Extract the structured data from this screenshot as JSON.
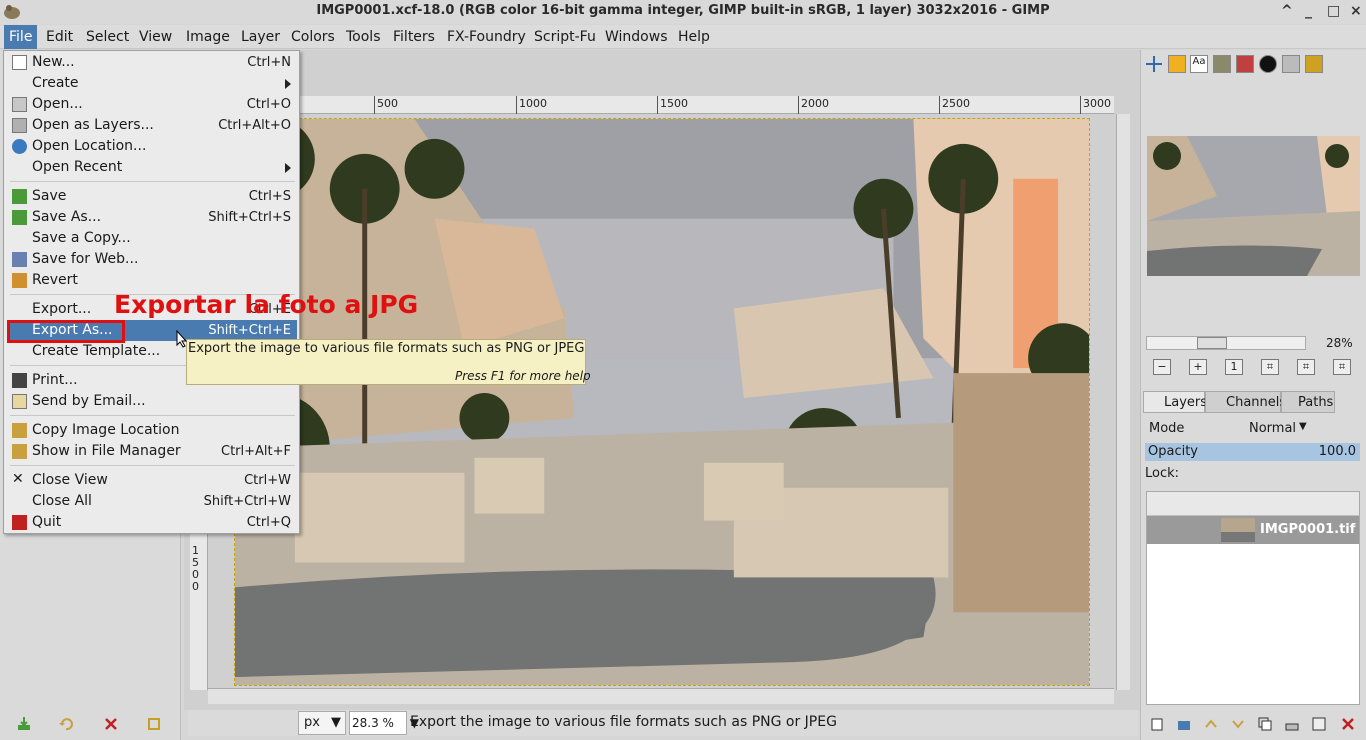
{
  "window": {
    "title": "IMGP0001.xcf-18.0 (RGB color 16-bit gamma integer, GIMP built-in sRGB, 1 layer) 3032x2016 - GIMP",
    "controls": [
      "^",
      "_",
      "□",
      "×"
    ]
  },
  "menubar": [
    "File",
    "Edit",
    "Select",
    "View",
    "Image",
    "Layer",
    "Colors",
    "Tools",
    "Filters",
    "FX-Foundry",
    "Script-Fu",
    "Windows",
    "Help"
  ],
  "file_menu": {
    "items": [
      {
        "label": "New...",
        "accel": "Ctrl+N"
      },
      {
        "label": "Create",
        "accel": ""
      },
      {
        "label": "Open...",
        "accel": "Ctrl+O"
      },
      {
        "label": "Open as Layers...",
        "accel": "Ctrl+Alt+O"
      },
      {
        "label": "Open Location...",
        "accel": ""
      },
      {
        "label": "Open Recent",
        "accel": ""
      },
      {
        "label": "Save",
        "accel": "Ctrl+S"
      },
      {
        "label": "Save As...",
        "accel": "Shift+Ctrl+S"
      },
      {
        "label": "Save a Copy...",
        "accel": ""
      },
      {
        "label": "Save for Web...",
        "accel": ""
      },
      {
        "label": "Revert",
        "accel": ""
      },
      {
        "label": "Export...",
        "accel": "Ctrl+E"
      },
      {
        "label": "Export As...",
        "accel": "Shift+Ctrl+E"
      },
      {
        "label": "Create Template...",
        "accel": ""
      },
      {
        "label": "Print...",
        "accel": ""
      },
      {
        "label": "Send by Email...",
        "accel": ""
      },
      {
        "label": "Copy Image Location",
        "accel": ""
      },
      {
        "label": "Show in File Manager",
        "accel": "Ctrl+Alt+F"
      },
      {
        "label": "Close View",
        "accel": "Ctrl+W"
      },
      {
        "label": "Close All",
        "accel": "Shift+Ctrl+W"
      },
      {
        "label": "Quit",
        "accel": "Ctrl+Q"
      }
    ]
  },
  "annotation": "Exportar la foto a JPG",
  "tooltip": {
    "text": "Export the image to various file formats such as PNG or JPEG",
    "help": "Press F1 for more help"
  },
  "ruler": {
    "h_labels": [
      "500",
      "1000",
      "1500",
      "2000",
      "2500",
      "3000"
    ],
    "v_labels": [
      "1",
      "5",
      "0",
      "0"
    ]
  },
  "statusbar": {
    "unit": "px",
    "zoom": "28.3 %",
    "message": "Export the image to various file formats such as PNG or JPEG"
  },
  "navigator": {
    "zoom_label": "28%"
  },
  "layers_panel": {
    "tabs": [
      "Layers",
      "Channels",
      "Paths"
    ],
    "mode_label": "Mode",
    "mode_value": "Normal",
    "opacity_label": "Opacity",
    "opacity_value": "100.0",
    "lock_label": "Lock:",
    "layer_name": "IMGP0001.tif"
  },
  "colors": {
    "highlight": "#4a7bb0",
    "annotation": "#e01010",
    "tooltip_bg": "#f6f1c4"
  }
}
